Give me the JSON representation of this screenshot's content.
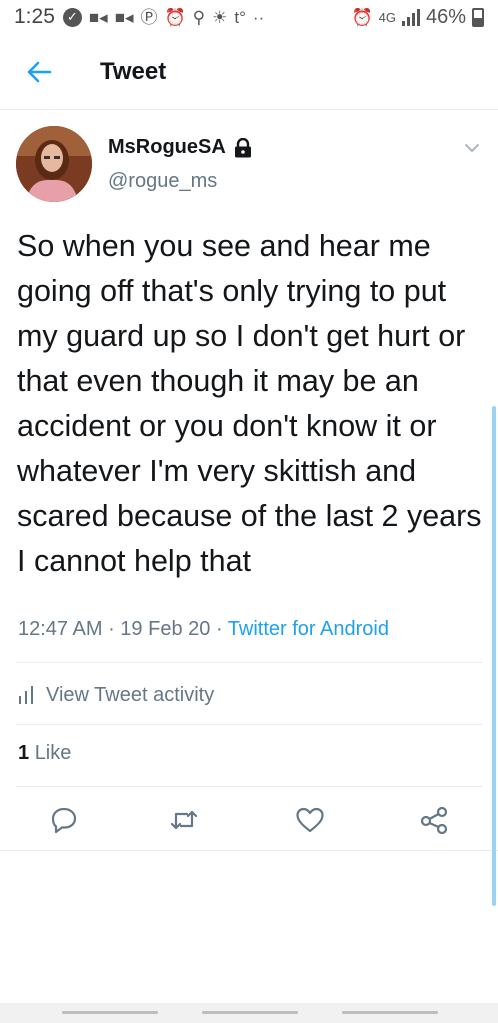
{
  "status_bar": {
    "time": "1:25",
    "battery": "46%",
    "network": "4G",
    "icons": [
      "check-circle-icon",
      "video-icon",
      "video-icon",
      "clock-icon",
      "alarm-icon",
      "search-icon",
      "sun-icon",
      "t-icon",
      "more-icon",
      "alarm-icon",
      "signal-icon",
      "battery-icon"
    ]
  },
  "header": {
    "title": "Tweet",
    "back_icon": "back-arrow-icon"
  },
  "tweet": {
    "display_name": "MsRogueSA",
    "handle": "@rogue_ms",
    "protected_icon": "lock-icon",
    "text": "So when you see and hear me going off that's only trying to put my guard up so I don't get hurt or that even though it may be an accident or you don't know it or whatever I'm very skittish and scared because of the last 2 years I cannot help that",
    "time": "12:47 AM",
    "date": "19 Feb 20",
    "source": "Twitter for Android",
    "activity_label": "View Tweet activity",
    "like_count": "1",
    "like_label": "Like"
  },
  "actions": [
    "reply-icon",
    "retweet-icon",
    "like-icon",
    "share-icon"
  ],
  "colors": {
    "accent": "#1da1f2",
    "text": "#14171a",
    "secondary": "#657786",
    "divider": "#e6ecf0"
  }
}
